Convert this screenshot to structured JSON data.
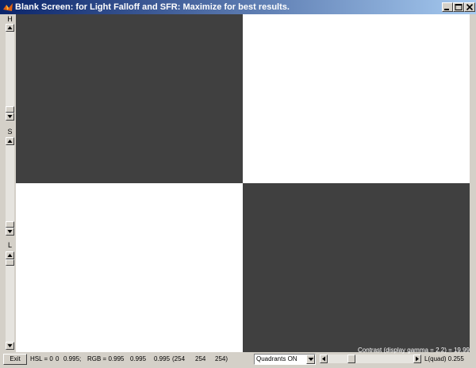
{
  "window": {
    "title": "Blank Screen:  for Light Falloff and SFR:  Maximize for best results."
  },
  "sliders": {
    "h": {
      "label": "H",
      "value": 0
    },
    "s": {
      "label": "S",
      "value": 0
    },
    "l": {
      "label": "L",
      "value": 0.995
    }
  },
  "quadrants": {
    "colors": {
      "dark": "#404040",
      "light": "#ffffff"
    }
  },
  "contrast": "Contrast (display gamma = 2.2) = 19.99",
  "exit_label": "Exit",
  "status": {
    "hsl_label": "HSL = 0",
    "hsl_s": "0",
    "hsl_l": "0.995;",
    "rgb_label": "RGB = 0.995",
    "rgb_g": "0.995",
    "rgb_b": "0.995",
    "byte_r": "(254",
    "byte_g": "254",
    "byte_b": "254)"
  },
  "quadrant_select": {
    "value": "Quadrants ON"
  },
  "lquad": {
    "label": "L(quad)  0.255",
    "value": 0.255
  }
}
